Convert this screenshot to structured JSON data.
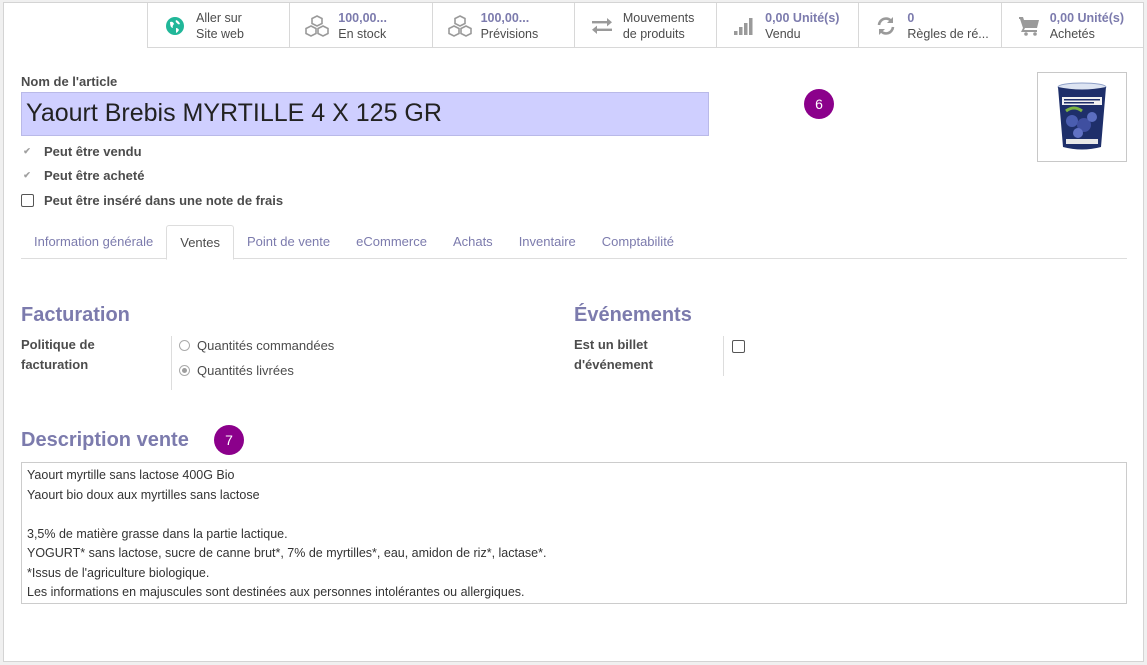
{
  "stat_buttons": [
    {
      "value": "",
      "label_line1": "Aller sur",
      "label_line2": "Site web",
      "icon": "globe-icon"
    },
    {
      "value": "100,00...",
      "label": "En stock",
      "icon": "cubes-icon"
    },
    {
      "value": "100,00...",
      "label": "Prévisions",
      "icon": "cubes-icon"
    },
    {
      "value": "",
      "label_line1": "Mouvements",
      "label_line2": "de produits",
      "icon": "exchange-arrows-icon"
    },
    {
      "value": "0,00 Unité(s)",
      "label": "Vendu",
      "icon": "signal-bars-icon"
    },
    {
      "value": "0",
      "label": "Règles de ré...",
      "icon": "refresh-icon"
    },
    {
      "value": "0,00 Unité(s)",
      "label": "Achetés",
      "icon": "shopping-cart-icon"
    }
  ],
  "product": {
    "name_label": "Nom de l'article",
    "name": "Yaourt Brebis MYRTILLE 4 X 125 GR",
    "badge_a": "6",
    "badge_b": "7",
    "image_alt": "yogurt-product-image"
  },
  "checkboxes": [
    {
      "label": "Peut être vendu",
      "checked": true
    },
    {
      "label": "Peut être acheté",
      "checked": true
    },
    {
      "label": "Peut être inséré dans une note de frais",
      "checked": false
    }
  ],
  "tabs": [
    {
      "label": "Information générale",
      "active": false
    },
    {
      "label": "Ventes",
      "active": true
    },
    {
      "label": "Point de vente",
      "active": false
    },
    {
      "label": "eCommerce",
      "active": false
    },
    {
      "label": "Achats",
      "active": false
    },
    {
      "label": "Inventaire",
      "active": false
    },
    {
      "label": "Comptabilité",
      "active": false
    }
  ],
  "facturation": {
    "title": "Facturation",
    "field_label_line1": "Politique de",
    "field_label_line2": "facturation",
    "options": [
      {
        "label": "Quantités commandées",
        "selected": false
      },
      {
        "label": "Quantités livrées",
        "selected": true
      }
    ]
  },
  "evenements": {
    "title": "Événements",
    "field_label_line1": "Est un billet",
    "field_label_line2": "d'événement",
    "checked": false
  },
  "description": {
    "title": "Description vente",
    "lines": [
      "Yaourt myrtille sans lactose 400G Bio",
      "Yaourt bio doux aux myrtilles sans lactose",
      "",
      "3,5% de matière grasse dans la partie lactique.",
      "YOGURT* sans lactose, sucre de canne brut*, 7% de myrtilles*, eau, amidon de riz*, lactase*.",
      "*Issus de l'agriculture biologique.",
      "Les informations en majuscules sont destinées aux personnes intolérantes ou allergiques."
    ]
  },
  "colors": {
    "accent": "#7c7bad",
    "name_field_bg": "#cfcfff",
    "badge": "#8b008b",
    "globe": "#21b799"
  }
}
